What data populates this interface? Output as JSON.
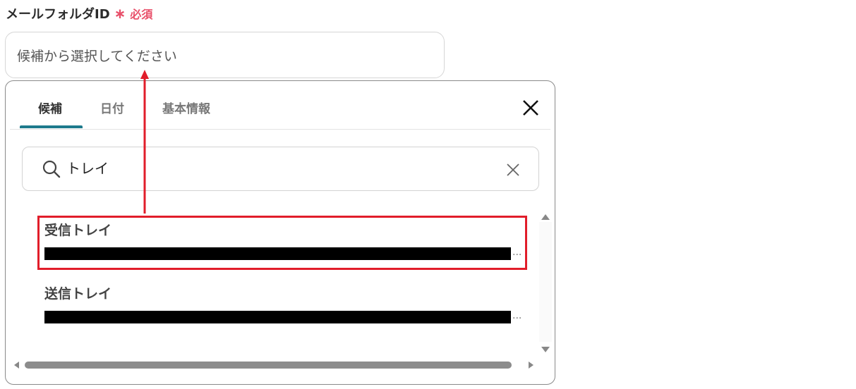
{
  "field": {
    "label": "メールフォルダID",
    "required_mark": "∗",
    "required_text": "必須",
    "placeholder": "候補から選択してください"
  },
  "dropdown": {
    "tabs": [
      {
        "label": "候補",
        "active": true
      },
      {
        "label": "日付",
        "active": false
      },
      {
        "label": "基本情報",
        "active": false
      }
    ],
    "search": {
      "value": "トレイ"
    },
    "options": [
      {
        "title": "受信トレイ",
        "subtitle_redacted": true,
        "ellipsis": "...",
        "highlighted": true
      },
      {
        "title": "送信トレイ",
        "subtitle_redacted": true,
        "ellipsis": "...",
        "highlighted": false
      }
    ]
  },
  "colors": {
    "accent_tab": "#1e7a8c",
    "required": "#e8506a",
    "highlight": "#e11d2a"
  },
  "icons": [
    "asterisk-icon",
    "close-icon",
    "search-icon",
    "clear-icon",
    "scroll-up-icon",
    "scroll-down-icon",
    "scroll-left-icon",
    "scroll-right-icon"
  ]
}
